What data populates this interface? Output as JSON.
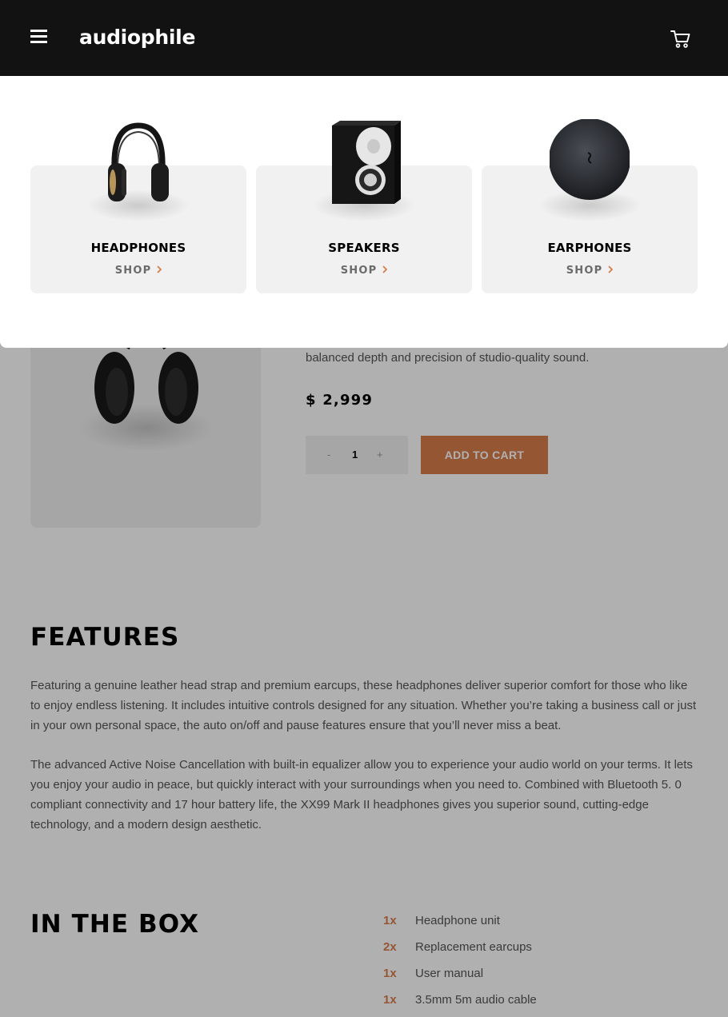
{
  "header": {
    "logo": "audiophile"
  },
  "menu": {
    "categories": [
      {
        "name": "HEADPHONES",
        "shop_label": "SHOP",
        "icon": "headphones-image"
      },
      {
        "name": "SPEAKERS",
        "shop_label": "SHOP",
        "icon": "speaker-image"
      },
      {
        "name": "EARPHONES",
        "shop_label": "SHOP",
        "icon": "earphones-image"
      }
    ]
  },
  "product": {
    "description_tail": "balanced depth and precision of studio-quality sound.",
    "price": "$ 2,999",
    "quantity": {
      "minus": "-",
      "value": "1",
      "plus": "+"
    },
    "add_to_cart": "ADD TO CART"
  },
  "features": {
    "title": "FEATURES",
    "paragraphs": [
      "Featuring a genuine leather head strap and premium earcups, these headphones deliver superior comfort for those who like to enjoy endless listening. It includes intuitive controls designed for any situation. Whether you’re taking a business call or just in your own personal space, the auto on/off and pause features ensure that you’ll never miss a beat.",
      "The advanced Active Noise Cancellation with built-in equalizer allow you to experience your audio world on your terms. It lets you enjoy your audio in peace, but quickly interact with your surroundings when you need to. Combined with Bluetooth 5. 0 compliant connectivity and 17 hour battery life, the XX99 Mark II headphones gives you superior sound, cutting-edge technology, and a modern design aesthetic."
    ]
  },
  "in_the_box": {
    "title": "IN THE BOX",
    "items": [
      {
        "qty": "1x",
        "name": "Headphone unit"
      },
      {
        "qty": "2x",
        "name": "Replacement earcups"
      },
      {
        "qty": "1x",
        "name": "User manual"
      },
      {
        "qty": "1x",
        "name": "3.5mm 5m audio cable"
      }
    ]
  },
  "colors": {
    "header_bg": "#121212",
    "accent": "#D87D4A",
    "card_bg": "#F1F1F1",
    "overlay": "rgba(0,0,0,0.31)"
  }
}
